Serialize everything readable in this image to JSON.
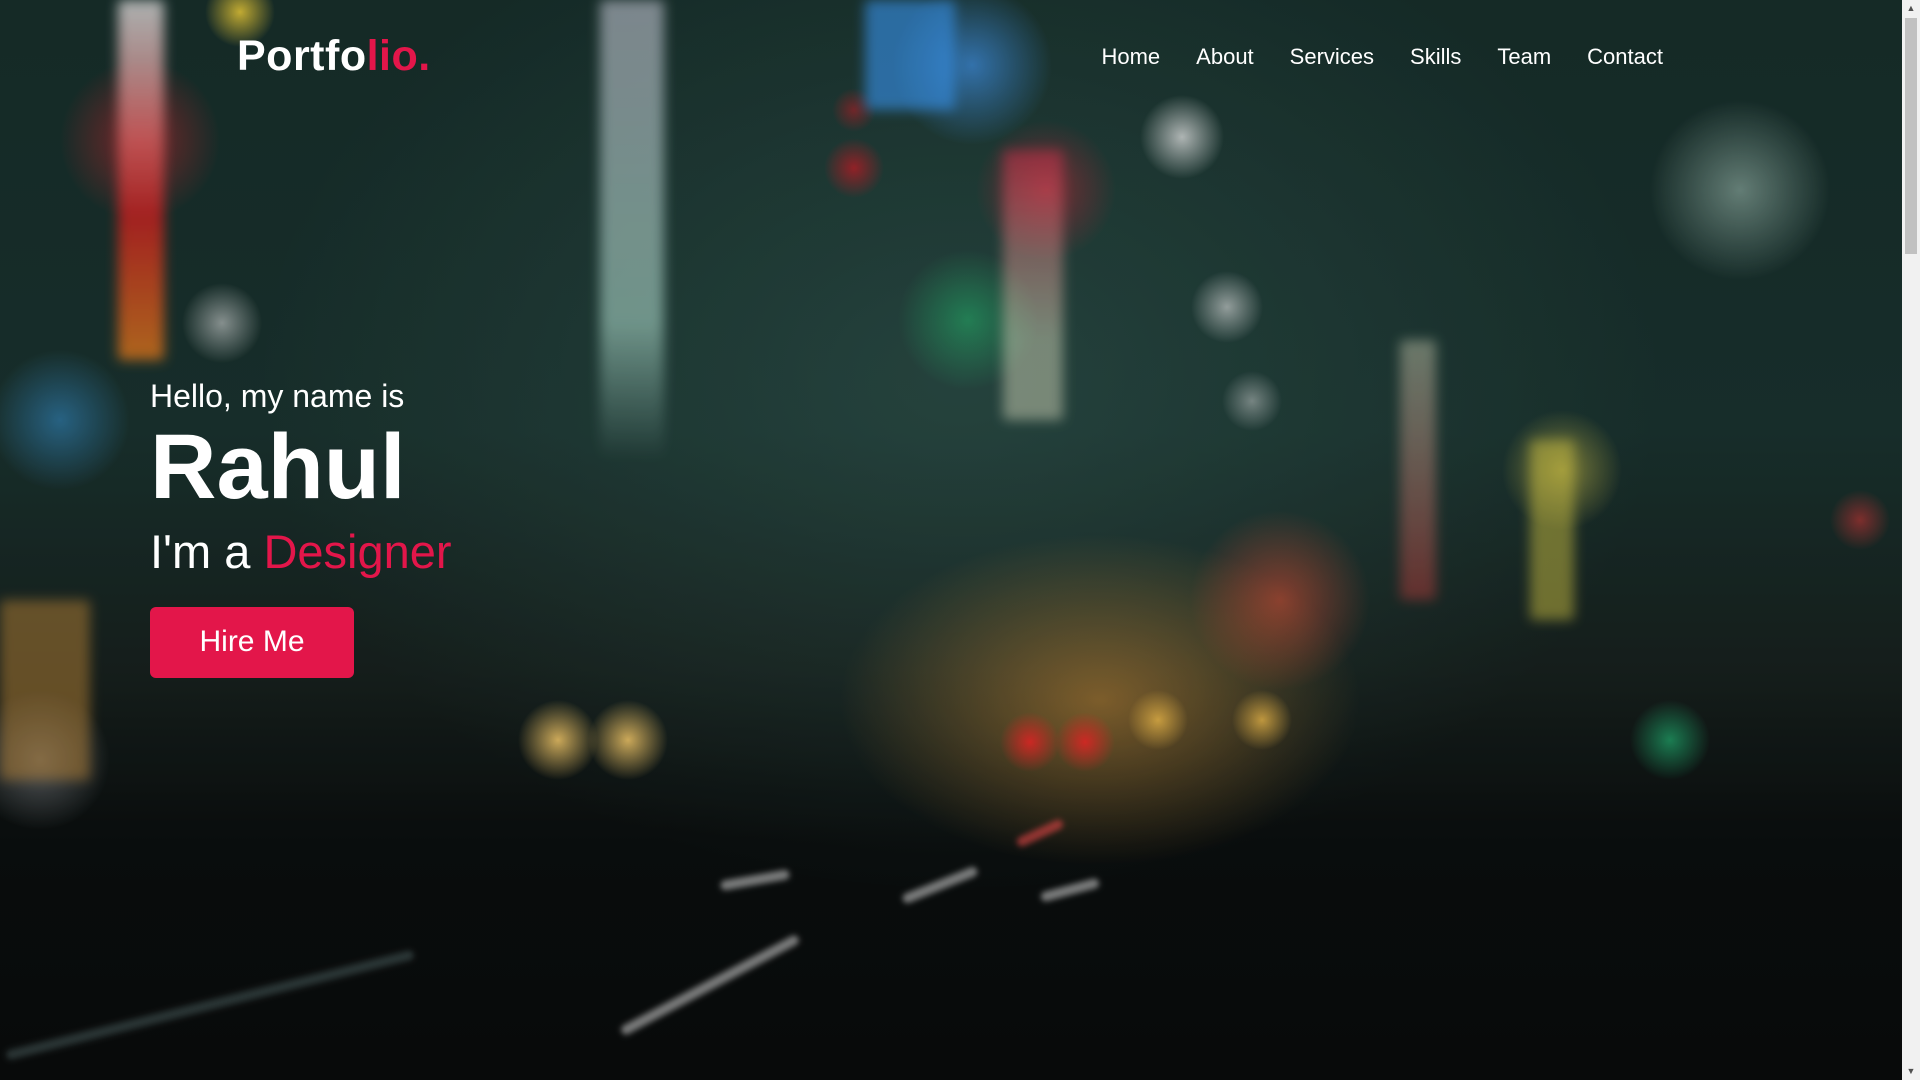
{
  "logo": {
    "text_main": "Portfo",
    "text_accent": "lio."
  },
  "nav": {
    "items": [
      {
        "label": "Home"
      },
      {
        "label": "About"
      },
      {
        "label": "Services"
      },
      {
        "label": "Skills"
      },
      {
        "label": "Team"
      },
      {
        "label": "Contact"
      }
    ]
  },
  "hero": {
    "greeting": "Hello, my name is",
    "name": "Rahul",
    "role_prefix": "I'm a ",
    "role_accent": "Designer",
    "cta_label": "Hire Me"
  },
  "scrollbar": {
    "up_icon": "▲",
    "down_icon": "▼"
  },
  "colors": {
    "accent": "#e3164a",
    "text": "#ffffff"
  }
}
